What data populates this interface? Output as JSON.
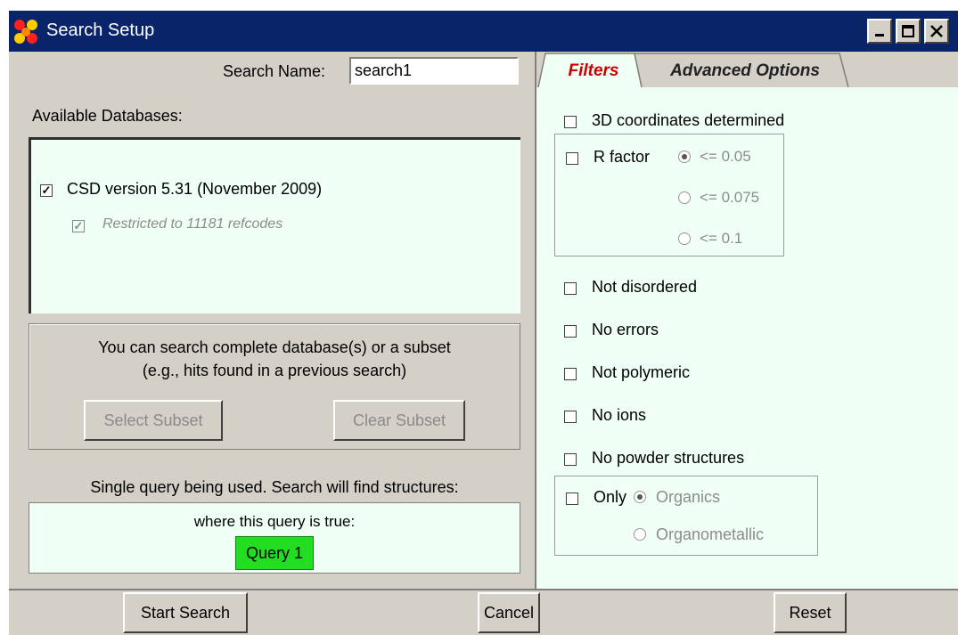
{
  "window": {
    "title": "Search Setup"
  },
  "left": {
    "search_name_label": "Search Name:",
    "search_name_value": "search1",
    "available_db_label": "Available Databases:",
    "db_item": {
      "label": "CSD version 5.31 (November 2009)",
      "checked": true
    },
    "db_restriction": {
      "label": "Restricted to 11181 refcodes",
      "checked": true
    },
    "subset_line1": "You can search complete database(s) or a subset",
    "subset_line2": "(e.g., hits found in a previous search)",
    "select_subset_label": "Select Subset",
    "clear_subset_label": "Clear Subset",
    "query_info": "Single query being used. Search will find structures:",
    "query_condition": "where this query is true:",
    "query_button": "Query 1"
  },
  "tabs": [
    {
      "label": "Filters",
      "active": true,
      "color": "#cc0000"
    },
    {
      "label": "Advanced Options",
      "active": false
    }
  ],
  "filters": {
    "coords": "3D coordinates determined",
    "rfactor_label": "R factor",
    "rfactor_options": [
      "<= 0.05",
      "<= 0.075",
      "<= 0.1"
    ],
    "not_disordered": "Not disordered",
    "no_errors": "No errors",
    "not_polymeric": "Not polymeric",
    "no_ions": "No ions",
    "no_powder": "No powder structures",
    "only_label": "Only",
    "only_options": [
      "Organics",
      "Organometallic"
    ]
  },
  "bottom": {
    "start_search": "Start Search",
    "cancel": "Cancel",
    "reset": "Reset"
  },
  "colors": {
    "titlebar": "#0a246a",
    "panel_bg": "#f0fff6",
    "query_green": "#22dd22"
  }
}
